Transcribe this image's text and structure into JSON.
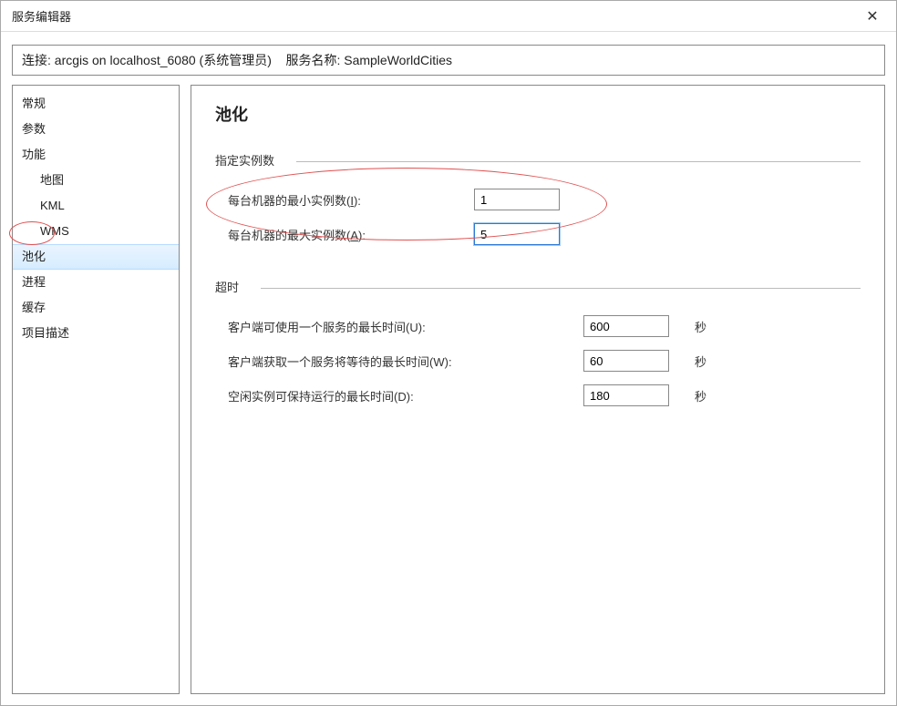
{
  "window": {
    "title": "服务编辑器"
  },
  "connection": {
    "prefix": "连接:",
    "value": "arcgis on localhost_6080 (系统管理员)",
    "service_label": "服务名称:",
    "service_name": "SampleWorldCities"
  },
  "nav": {
    "items": [
      {
        "label": "常规",
        "level": 0,
        "selected": false
      },
      {
        "label": "参数",
        "level": 0,
        "selected": false
      },
      {
        "label": "功能",
        "level": 0,
        "selected": false
      },
      {
        "label": "地图",
        "level": 1,
        "selected": false
      },
      {
        "label": "KML",
        "level": 1,
        "selected": false
      },
      {
        "label": "WMS",
        "level": 1,
        "selected": false
      },
      {
        "label": "池化",
        "level": 0,
        "selected": true
      },
      {
        "label": "进程",
        "level": 0,
        "selected": false
      },
      {
        "label": "缓存",
        "level": 0,
        "selected": false
      },
      {
        "label": "项目描述",
        "level": 0,
        "selected": false
      }
    ]
  },
  "panel": {
    "heading": "池化",
    "section_instances": "指定实例数",
    "min_label_pre": "每台机器的最小实例数(",
    "min_hotkey": "I",
    "min_label_post": "):",
    "min_value": "1",
    "max_label_pre": "每台机器的最大实例数(",
    "max_hotkey": "A",
    "max_label_post": "):",
    "max_value": "5",
    "section_timeout": "超时",
    "t1_pre": "客户端可使用一个服务的最长时间(",
    "t1_hotkey": "U",
    "t1_post": "):",
    "t1_value": "600",
    "t2_pre": "客户端获取一个服务将等待的最长时间(",
    "t2_hotkey": "W",
    "t2_post": "):",
    "t2_value": "60",
    "t3_pre": "空闲实例可保持运行的最长时间(",
    "t3_hotkey": "D",
    "t3_post": "):",
    "t3_value": "180",
    "unit": "秒"
  }
}
